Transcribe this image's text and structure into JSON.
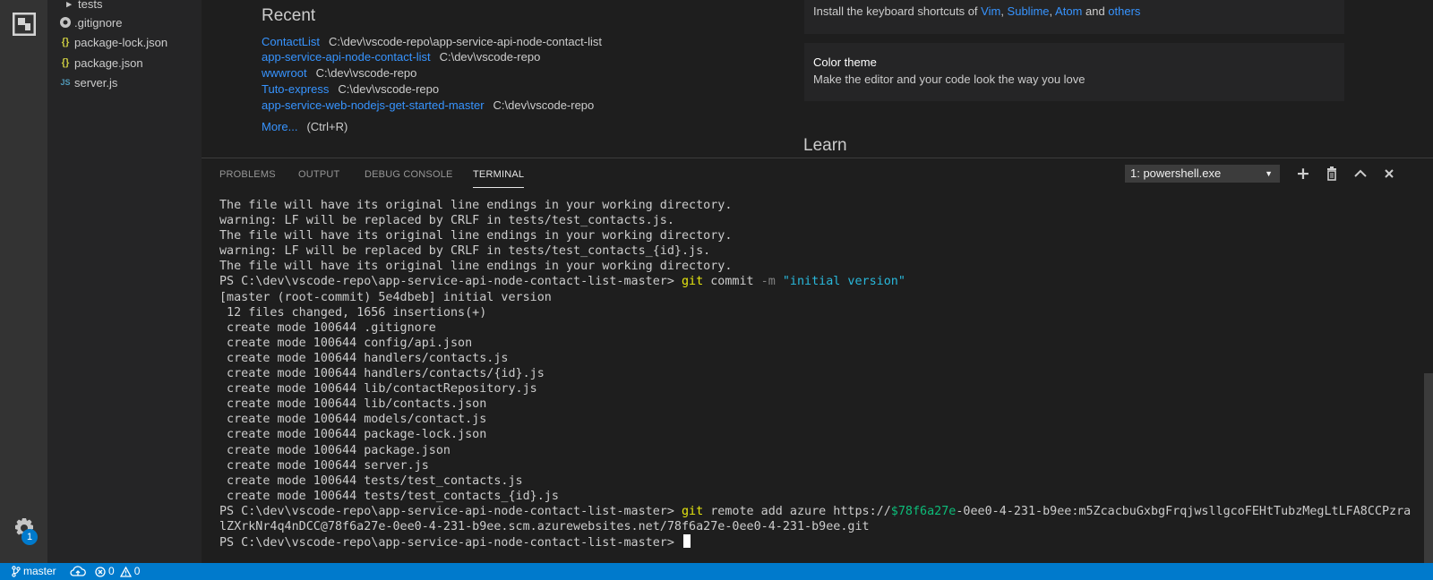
{
  "sidebar": {
    "items": [
      {
        "icon": "chevron-right-icon",
        "label": "tests"
      },
      {
        "icon": "git-icon",
        "label": ".gitignore"
      },
      {
        "icon": "json-icon",
        "glyph": "{}",
        "label": "package-lock.json"
      },
      {
        "icon": "json-icon",
        "glyph": "{}",
        "label": "package.json"
      },
      {
        "icon": "js-icon",
        "glyph": "JS",
        "label": "server.js"
      }
    ]
  },
  "activity": {
    "settings_badge": "1"
  },
  "welcome": {
    "recent_title": "Recent",
    "recent": [
      {
        "name": "ContactList",
        "path": "C:\\dev\\vscode-repo\\app-service-api-node-contact-list"
      },
      {
        "name": "app-service-api-node-contact-list",
        "path": "C:\\dev\\vscode-repo"
      },
      {
        "name": "wwwroot",
        "path": "C:\\dev\\vscode-repo"
      },
      {
        "name": "Tuto-express",
        "path": "C:\\dev\\vscode-repo"
      },
      {
        "name": "app-service-web-nodejs-get-started-master",
        "path": "C:\\dev\\vscode-repo"
      }
    ],
    "more_label": "More...",
    "more_shortcut": "(Ctrl+R)",
    "keymaps": {
      "prefix": "Install the keyboard shortcuts of ",
      "vim": "Vim",
      "sep1": ", ",
      "sublime": "Sublime",
      "sep2": ", ",
      "atom": "Atom",
      "and": " and ",
      "others": "others"
    },
    "color_theme": {
      "title": "Color theme",
      "desc": "Make the editor and your code look the way you love"
    },
    "learn_title": "Learn"
  },
  "panel": {
    "tabs": [
      "PROBLEMS",
      "OUTPUT",
      "DEBUG CONSOLE",
      "TERMINAL"
    ],
    "active_tab": "TERMINAL",
    "terminal_select": "1: powershell.exe",
    "actions": [
      "new-terminal",
      "kill-terminal",
      "maximize-panel",
      "close-panel"
    ]
  },
  "terminal": {
    "lines": [
      "The file will have its original line endings in your working directory.",
      "warning: LF will be replaced by CRLF in tests/test_contacts.js.",
      "The file will have its original line endings in your working directory.",
      "warning: LF will be replaced by CRLF in tests/test_contacts_{id}.js.",
      "The file will have its original line endings in your working directory."
    ],
    "commit_prompt": "PS C:\\dev\\vscode-repo\\app-service-api-node-contact-list-master> ",
    "commit_cmd": "git",
    "commit_sub": " commit ",
    "commit_opt": "-m",
    "commit_msg": "\"initial version\"",
    "commit_output": [
      "[master (root-commit) 5e4dbeb] initial version",
      " 12 files changed, 1656 insertions(+)",
      " create mode 100644 .gitignore",
      " create mode 100644 config/api.json",
      " create mode 100644 handlers/contacts.js",
      " create mode 100644 handlers/contacts/{id}.js",
      " create mode 100644 lib/contactRepository.js",
      " create mode 100644 lib/contacts.json",
      " create mode 100644 models/contact.js",
      " create mode 100644 package-lock.json",
      " create mode 100644 package.json",
      " create mode 100644 server.js",
      " create mode 100644 tests/test_contacts.js",
      " create mode 100644 tests/test_contacts_{id}.js"
    ],
    "remote_prompt": "PS C:\\dev\\vscode-repo\\app-service-api-node-contact-list-master> ",
    "remote_cmd": "git",
    "remote_args": " remote add azure https://",
    "remote_var": "$78f6a27e",
    "remote_rest": "-0ee0-4-231-b9ee:m5ZcacbuGxbgFrqjwsllgcoFEHtTubzMegLtLFA8CCPzra",
    "remote_wrap": "lZXrkNr4q4nDCC@78f6a27e-0ee0-4-231-b9ee.scm.azurewebsites.net/78f6a27e-0ee0-4-231-b9ee.git",
    "final_prompt": "PS C:\\dev\\vscode-repo\\app-service-api-node-contact-list-master> "
  },
  "status": {
    "branch": "master",
    "errors": "0",
    "warnings": "0"
  },
  "colors": {
    "accent": "#007acc",
    "link": "#3794ff",
    "command": "#e5e510",
    "string": "#29b8db",
    "variable": "#0dbc79"
  }
}
